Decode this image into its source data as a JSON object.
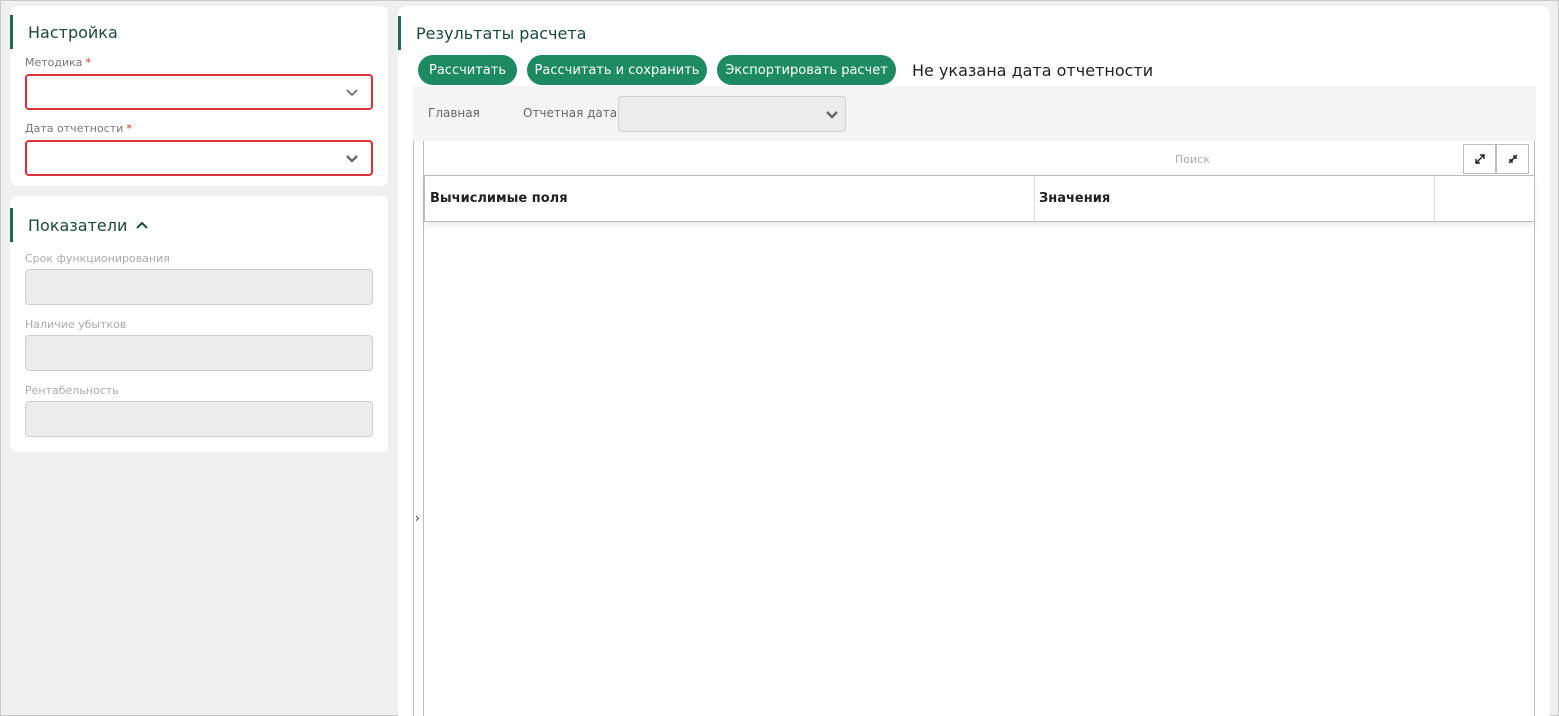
{
  "settings": {
    "title": "Настройка",
    "method_label": "Методика",
    "date_label": "Дата отчетности",
    "required_mark": "*"
  },
  "indicators": {
    "title": "Показатели",
    "fields": [
      {
        "label": "Срок функционирования"
      },
      {
        "label": "Наличие убытков"
      },
      {
        "label": "Рентабельность"
      }
    ]
  },
  "results": {
    "title": "Результаты расчета",
    "buttons": {
      "calculate": "Рассчитать",
      "calculate_save": "Рассчитать и сохранить",
      "export": "Экспортировать расчет"
    },
    "status": "Не указана дата отчетности",
    "toolbar": {
      "main_tab": "Главная",
      "report_date_label": "Отчетная дата"
    },
    "grid": {
      "search_placeholder": "Поиск",
      "columns": [
        "Вычислимые поля",
        "Значения"
      ],
      "side_toggle": "›"
    }
  },
  "colors": {
    "accent": "#1d8a63",
    "title_bar": "#1a6e4f",
    "error_border": "#d8323c"
  }
}
